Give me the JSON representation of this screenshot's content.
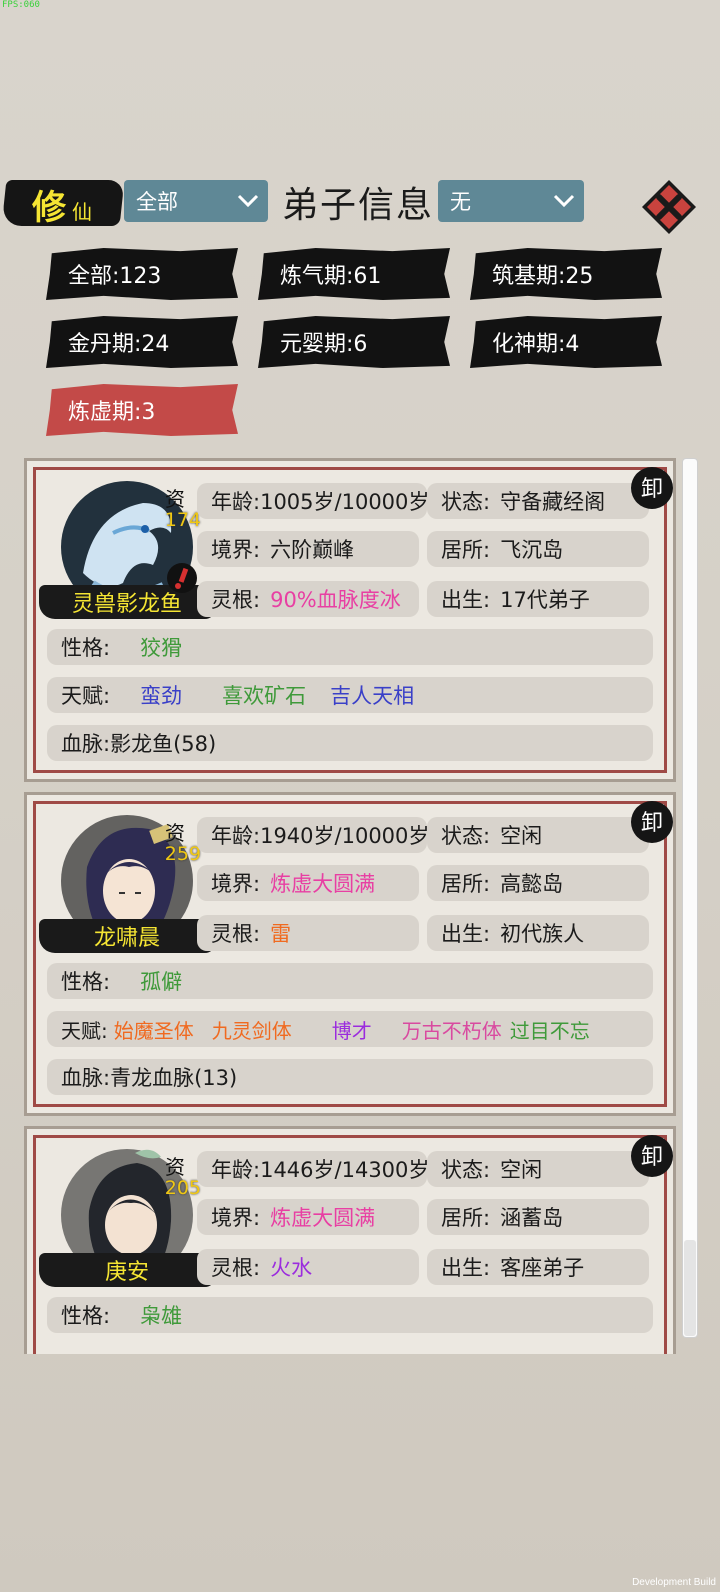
{
  "fps": "FPS:060",
  "dev_build": "Development Build",
  "header": {
    "xiu": "修",
    "xian": "仙",
    "filter_left": "全部",
    "title": "弟子信息",
    "filter_right": "无"
  },
  "chips": [
    {
      "label": "全部:123"
    },
    {
      "label": "炼气期:61"
    },
    {
      "label": "筑基期:25"
    },
    {
      "label": "金丹期:24"
    },
    {
      "label": "元婴期:6"
    },
    {
      "label": "化神期:4"
    },
    {
      "label": "炼虚期:3"
    }
  ],
  "labels": {
    "zi": "资",
    "age": "年龄:",
    "status": "状态:",
    "realm": "境界:",
    "residence": "居所:",
    "root": "灵根:",
    "birth": "出生:",
    "personality": "性格:",
    "talent": "天赋:",
    "bloodline": "血脉:",
    "seal": "卸"
  },
  "disciples": [
    {
      "name": "灵兽影龙鱼",
      "aptitude": "174",
      "age": "1005岁/10000岁",
      "status": "守备藏经阁",
      "realm": "六阶巅峰",
      "residence": "飞沉岛",
      "root": "90%血脉度冰",
      "birth": "17代弟子",
      "personality": "狡猾",
      "talents": [
        "蛮劲",
        "喜欢矿石",
        "吉人天相"
      ],
      "bloodline": "影龙鱼(58)"
    },
    {
      "name": "龙啸晨",
      "aptitude": "259",
      "age": "1940岁/10000岁",
      "status": "空闲",
      "realm": "炼虚大圆满",
      "residence": "高懿岛",
      "root": "雷",
      "birth": "初代族人",
      "personality": "孤僻",
      "talents": [
        "始魔圣体",
        "九灵剑体",
        "博才",
        "万古不朽体",
        "过目不忘"
      ],
      "bloodline": "青龙血脉(13)"
    },
    {
      "name": "庚安",
      "aptitude": "205",
      "age": "1446岁/14300岁",
      "status": "空闲",
      "realm": "炼虚大圆满",
      "residence": "涵蓄岛",
      "root": "火水",
      "birth": "客座弟子",
      "personality": "枭雄"
    }
  ]
}
